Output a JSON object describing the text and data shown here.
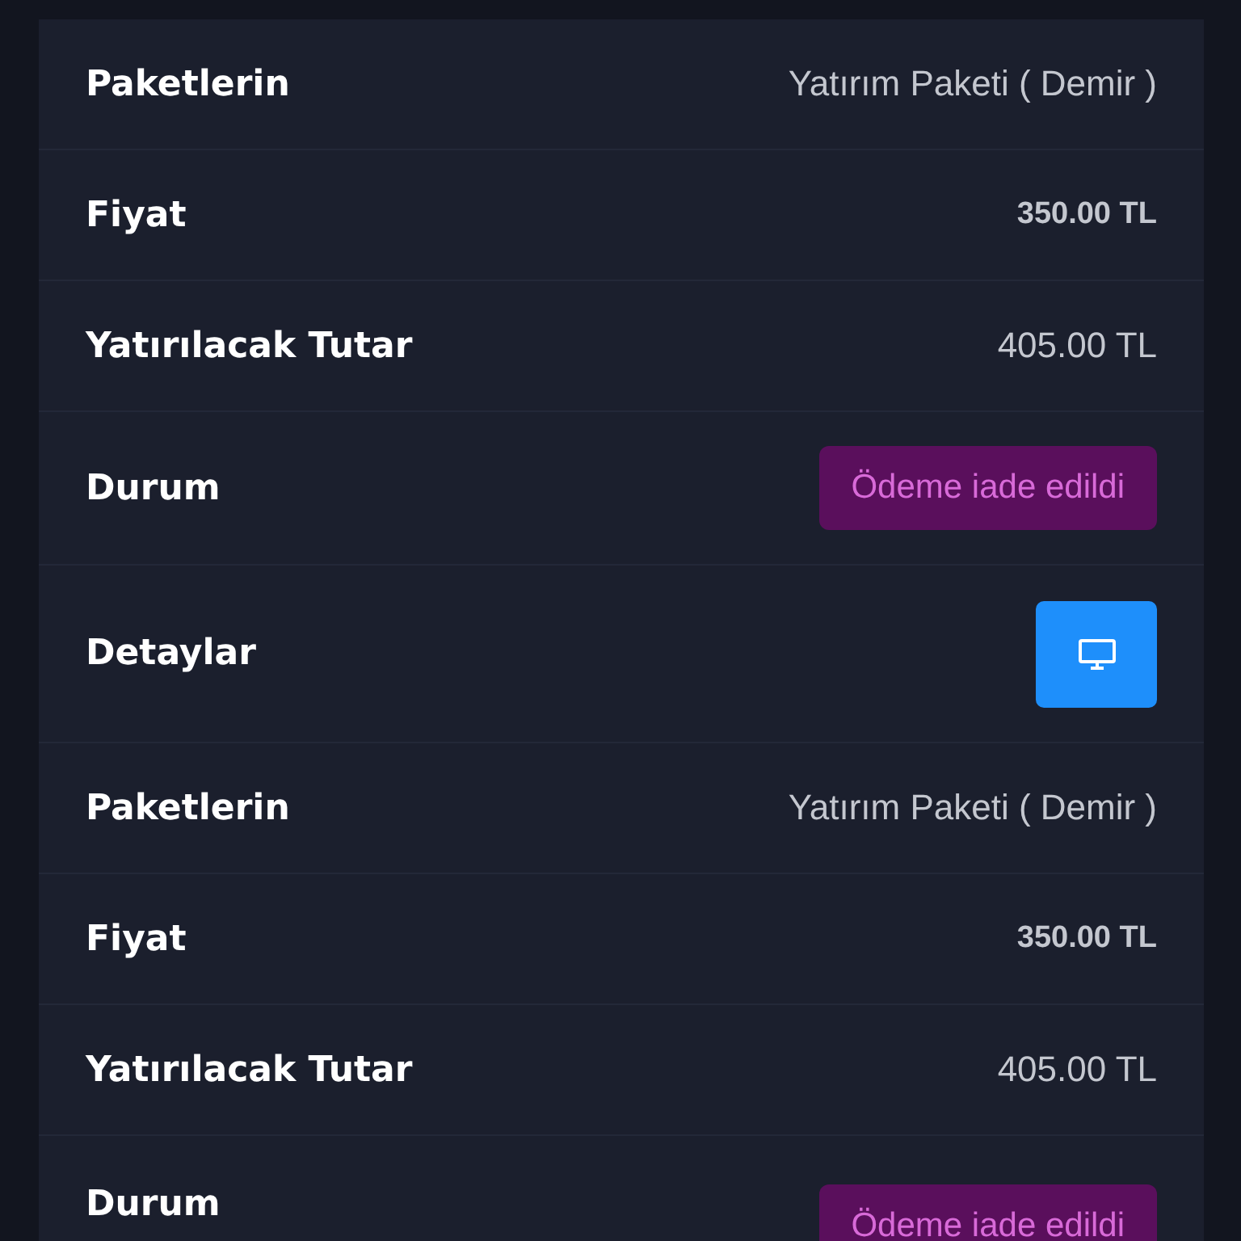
{
  "records": [
    {
      "rows": [
        {
          "kind": "text",
          "label": "Paketlerin",
          "value": "Yatırım Paketi ( Demir )"
        },
        {
          "kind": "strong",
          "label": "Fiyat",
          "value": "350.00 TL"
        },
        {
          "kind": "text",
          "label": "Yatırılacak Tutar",
          "value": "405.00 TL"
        },
        {
          "kind": "badge",
          "label": "Durum",
          "value": "Ödeme iade edildi"
        },
        {
          "kind": "button",
          "label": "Detaylar"
        }
      ]
    },
    {
      "rows": [
        {
          "kind": "text",
          "label": "Paketlerin",
          "value": "Yatırım Paketi ( Demir )"
        },
        {
          "kind": "strong",
          "label": "Fiyat",
          "value": "350.00 TL"
        },
        {
          "kind": "text",
          "label": "Yatırılacak Tutar",
          "value": "405.00 TL"
        },
        {
          "kind": "badge",
          "label": "Durum",
          "value": "Ödeme iade edildi"
        }
      ]
    }
  ]
}
